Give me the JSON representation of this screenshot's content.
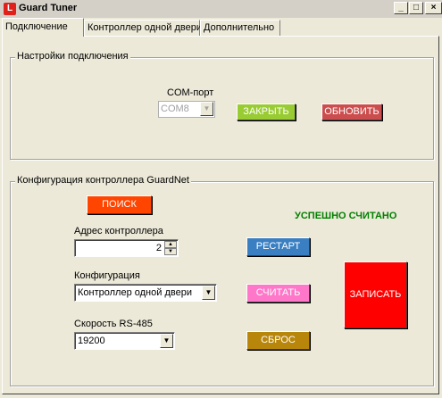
{
  "window": {
    "title": "Guard Tuner",
    "min_label": "_",
    "max_label": "□",
    "close_label": "×"
  },
  "tabs": [
    {
      "label": "Подключение",
      "active": true
    },
    {
      "label": "Контроллер одной двери",
      "active": false
    },
    {
      "label": "Дополнительно",
      "active": false
    }
  ],
  "connection": {
    "group_title": "Настройки подключения",
    "com_label": "COM-порт",
    "com_value": "COM8",
    "close_button": "ЗАКРЫТЬ",
    "refresh_button": "ОБНОВИТЬ"
  },
  "config": {
    "group_title": "Конфигурация контроллера GuardNet",
    "search_button": "ПОИСК",
    "status_text": "УСПЕШНО СЧИТАНО",
    "address_label": "Адрес контроллера",
    "address_value": "2",
    "config_label": "Конфигурация",
    "config_value": "Контроллер одной двери",
    "speed_label": "Скорость RS-485",
    "speed_value": "19200",
    "restart_button": "РЕСТАРТ",
    "read_button": "СЧИТАТЬ",
    "reset_button": "СБРОС",
    "write_button": "ЗАПИСАТЬ"
  },
  "colors": {
    "close_button": "#99cc33",
    "refresh_button": "#cc4d4d",
    "search_button": "#ff4500",
    "status_text": "#008000",
    "restart_button": "#3a7fc2",
    "read_button": "#ff77c8",
    "reset_button": "#b8860b",
    "write_button": "#ff0000"
  }
}
